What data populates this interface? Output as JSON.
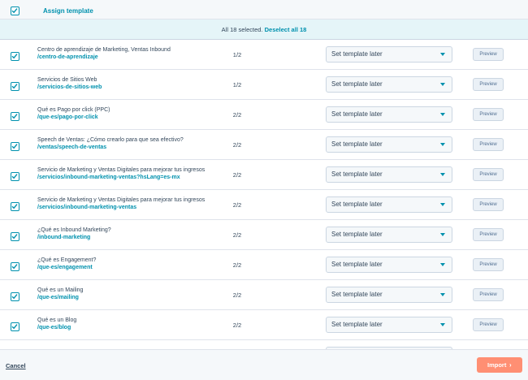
{
  "header": {
    "assign_label": "Assign template"
  },
  "banner": {
    "selected_text": "All 18 selected.",
    "deselect_label": "Deselect all 18"
  },
  "rows": [
    {
      "title": "Centro de aprendizaje de Marketing, Ventas Inbound",
      "slug": "/centro-de-aprendizaje",
      "fraction": "1/2",
      "template": "Set template later",
      "preview": "Preview"
    },
    {
      "title": "Servicios de Sitios Web",
      "slug": "/servicios-de-sitios-web",
      "fraction": "1/2",
      "template": "Set template later",
      "preview": "Preview"
    },
    {
      "title": "Qué es Pago por click (PPC)",
      "slug": "/que-es/pago-por-click",
      "fraction": "2/2",
      "template": "Set template later",
      "preview": "Preview"
    },
    {
      "title": "Speech de Ventas: ¿Cómo crearlo para que sea efectivo?",
      "slug": "/ventas/speech-de-ventas",
      "fraction": "2/2",
      "template": "Set template later",
      "preview": "Preview"
    },
    {
      "title": "Servicio de Marketing y Ventas Digitales para mejorar tus ingresos",
      "slug": "/servicios/inbound-marketing-ventas?hsLang=es-mx",
      "fraction": "2/2",
      "template": "Set template later",
      "preview": "Preview"
    },
    {
      "title": "Servicio de Marketing y Ventas Digitales para mejorar tus ingresos",
      "slug": "/servicios/inbound-marketing-ventas",
      "fraction": "2/2",
      "template": "Set template later",
      "preview": "Preview"
    },
    {
      "title": "¿Qué es Inbound Marketing?",
      "slug": "/inbound-marketing",
      "fraction": "2/2",
      "template": "Set template later",
      "preview": "Preview"
    },
    {
      "title": "¿Qué es Engagement?",
      "slug": "/que-es/engagement",
      "fraction": "2/2",
      "template": "Set template later",
      "preview": "Preview"
    },
    {
      "title": "Qué es un Mailing",
      "slug": "/que-es/mailing",
      "fraction": "2/2",
      "template": "Set template later",
      "preview": "Preview"
    },
    {
      "title": "Qué es un Blog",
      "slug": "/que-es/blog",
      "fraction": "2/2",
      "template": "Set template later",
      "preview": "Preview"
    }
  ],
  "footer": {
    "cancel_label": "Cancel",
    "import_label": "Import"
  },
  "icons": {
    "checkbox": "checkbox-checked-icon",
    "dropdown": "caret-down-icon",
    "chevron": "chevron-right-icon"
  },
  "colors": {
    "accent": "#0091ae",
    "primary_button": "#ff8f73",
    "banner_bg": "#e5f5f8"
  }
}
